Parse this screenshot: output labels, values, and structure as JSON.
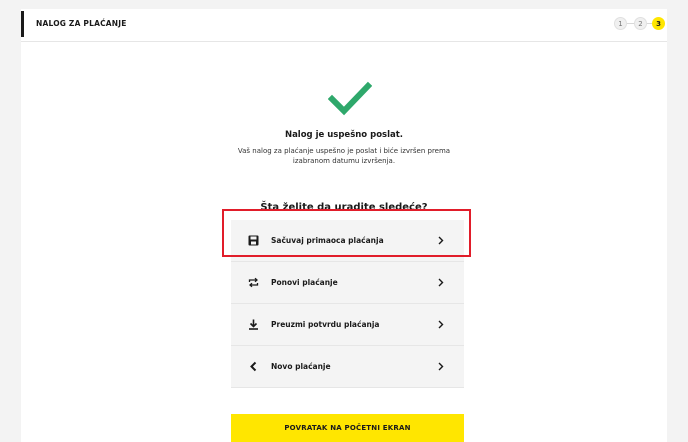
{
  "header": {
    "title": "NALOG ZA PLAĆANJE",
    "steps": [
      "1",
      "2",
      "3"
    ],
    "active_step": "3"
  },
  "confirmation": {
    "title": "Nalog je uspešno poslat.",
    "body": "Vaš nalog za plaćanje uspešno je poslat i biće izvršen prema izabranom datumu izvršenja."
  },
  "next": {
    "question": "Šta želite da uradite sledeće?",
    "options": [
      {
        "label": "Sačuvaj primaoca plaćanja",
        "icon": "save-icon"
      },
      {
        "label": "Ponovi plaćanje",
        "icon": "repeat-icon"
      },
      {
        "label": "Preuzmi potvrdu plaćanja",
        "icon": "download-icon"
      },
      {
        "label": "Novo plaćanje",
        "icon": "back-arrow-icon"
      }
    ]
  },
  "footer": {
    "return_label": "POVRATAK NA POČETNI EKRAN"
  },
  "colors": {
    "accent": "#ffe600",
    "success": "#2ea86b",
    "highlight": "#e11d2a"
  }
}
